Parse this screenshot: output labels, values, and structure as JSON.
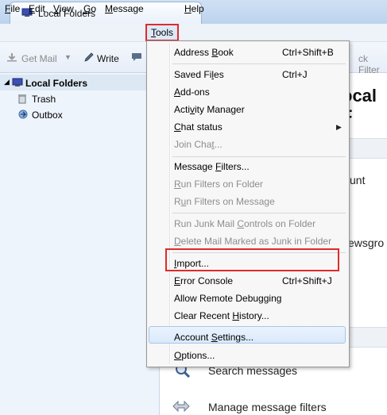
{
  "window": {
    "tab_title": "Local Folders"
  },
  "menubar": {
    "items": [
      "File",
      "Edit",
      "View",
      "Go",
      "Message",
      "Tools",
      "Help"
    ]
  },
  "toolbar": {
    "get_mail": "Get Mail",
    "write": "Write",
    "quick_filter_partial": "ck Filter"
  },
  "folders": {
    "account": "Local Folders",
    "items": [
      "Trash",
      "Outbox"
    ]
  },
  "content": {
    "title_partial": "ocal F",
    "line1_partial": "unt",
    "line2_partial": "ewsgro",
    "search": "Search messages",
    "filters": "Manage message filters"
  },
  "tools_menu": {
    "address_book": "Address Book",
    "address_book_shortcut": "Ctrl+Shift+B",
    "saved_files": "Saved Files",
    "saved_files_shortcut": "Ctrl+J",
    "add_ons": "Add-ons",
    "activity_manager": "Activity Manager",
    "chat_status": "Chat status",
    "join_chat": "Join Chat...",
    "message_filters": "Message Filters...",
    "run_filters_folder": "Run Filters on Folder",
    "run_filters_message": "Run Filters on Message",
    "run_junk": "Run Junk Mail Controls on Folder",
    "delete_junk": "Delete Mail Marked as Junk in Folder",
    "import": "Import...",
    "error_console": "Error Console",
    "error_console_shortcut": "Ctrl+Shift+J",
    "remote_debugging": "Allow Remote Debugging",
    "clear_history": "Clear Recent History...",
    "account_settings": "Account Settings...",
    "options": "Options..."
  },
  "colors": {
    "highlight": "#e02a2a",
    "accent": "#5b8bd4"
  }
}
